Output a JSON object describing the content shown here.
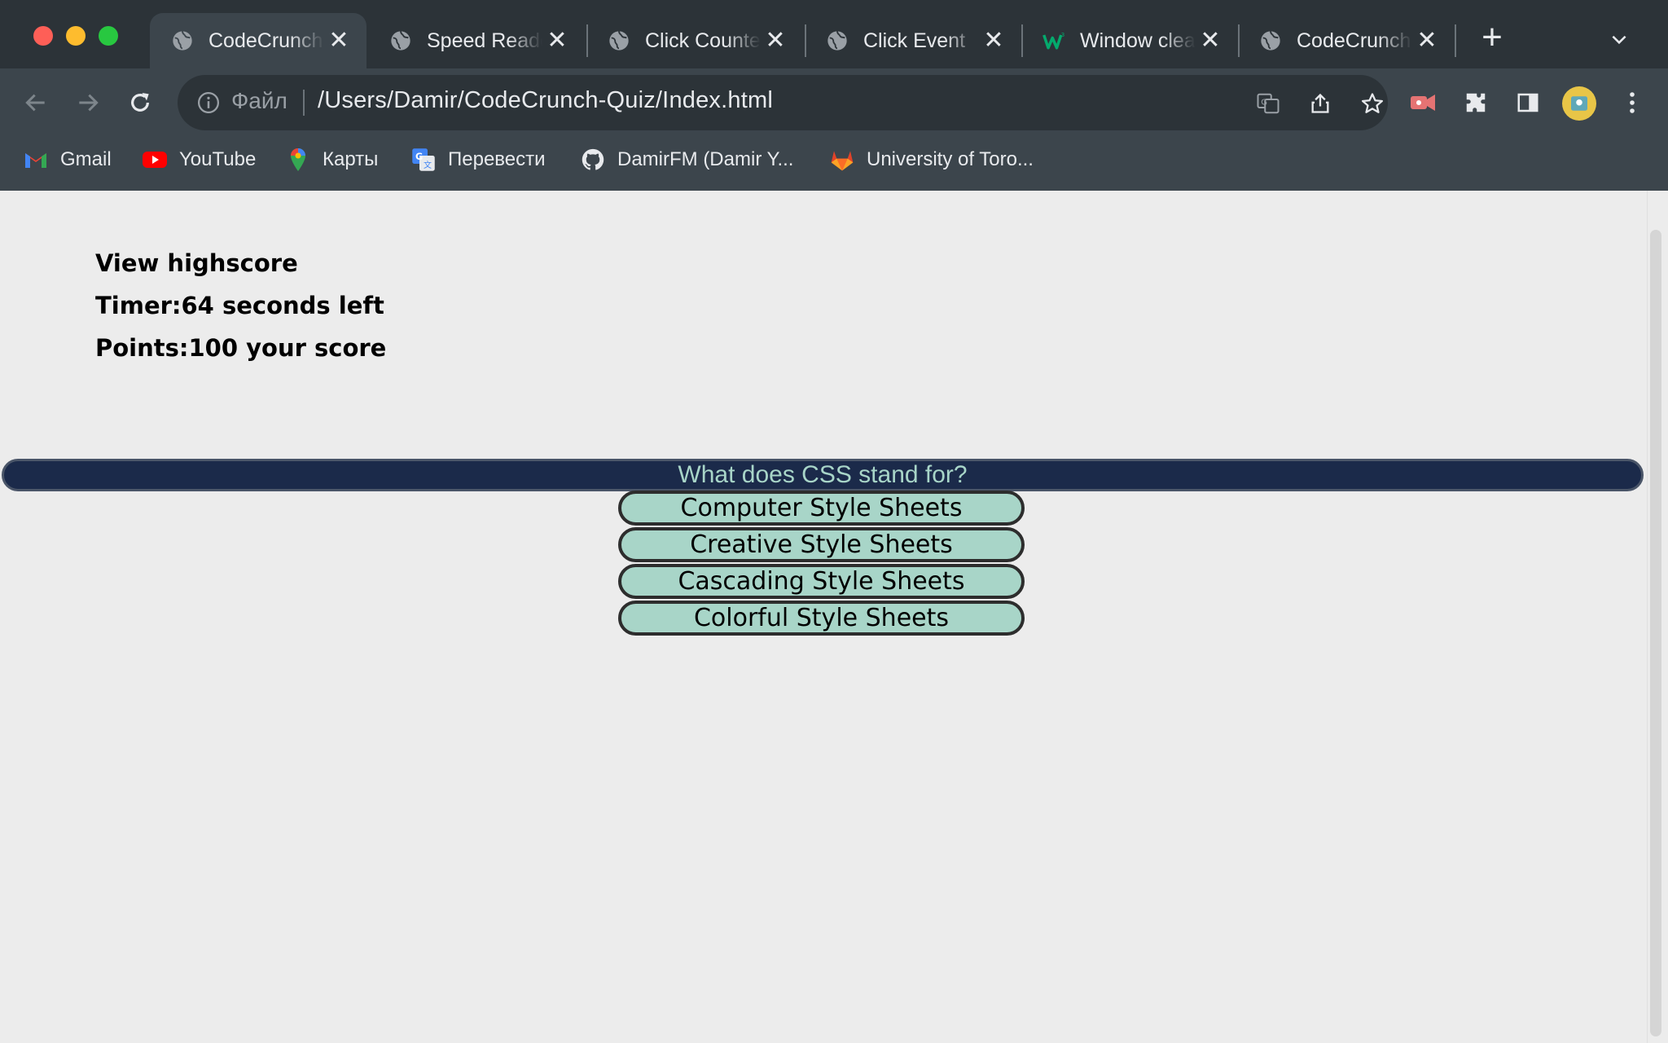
{
  "browser": {
    "tabs": [
      {
        "title": "CodeCrunch-Quiz",
        "favicon": "globe-icon",
        "active": true
      },
      {
        "title": "Speed Reader",
        "favicon": "globe-icon",
        "active": false
      },
      {
        "title": "Click Counter",
        "favicon": "globe-icon",
        "active": false
      },
      {
        "title": "Click Event",
        "favicon": "globe-icon",
        "active": false
      },
      {
        "title": "Window clearInterval",
        "favicon": "w3schools-icon",
        "active": false
      },
      {
        "title": "CodeCrunch-Quiz",
        "favicon": "globe-icon",
        "active": false
      }
    ],
    "address": {
      "scheme_label": "Файл",
      "url": "/Users/Damir/CodeCrunch-Quiz/Index.html"
    },
    "bookmarks": [
      {
        "label": "Gmail",
        "icon": "gmail-icon"
      },
      {
        "label": "YouTube",
        "icon": "youtube-icon"
      },
      {
        "label": "Карты",
        "icon": "maps-icon"
      },
      {
        "label": "Перевести",
        "icon": "translate-icon"
      },
      {
        "label": "DamirFM (Damir Y...",
        "icon": "github-icon"
      },
      {
        "label": "University of Toro...",
        "icon": "gitlab-icon"
      }
    ]
  },
  "page": {
    "view_highscore": "View highscore",
    "timer_text": "Timer:64 seconds left",
    "points_text": "Points:100 your score",
    "question": "What does CSS stand for?",
    "answers": [
      "Computer Style Sheets",
      "Creative Style Sheets",
      "Cascading Style Sheets",
      "Colorful Style Sheets"
    ]
  },
  "colors": {
    "question_bg": "#1b2a4a",
    "question_text": "#a8d5c8",
    "answer_bg": "#a8d5c8",
    "page_bg": "#ececec"
  }
}
